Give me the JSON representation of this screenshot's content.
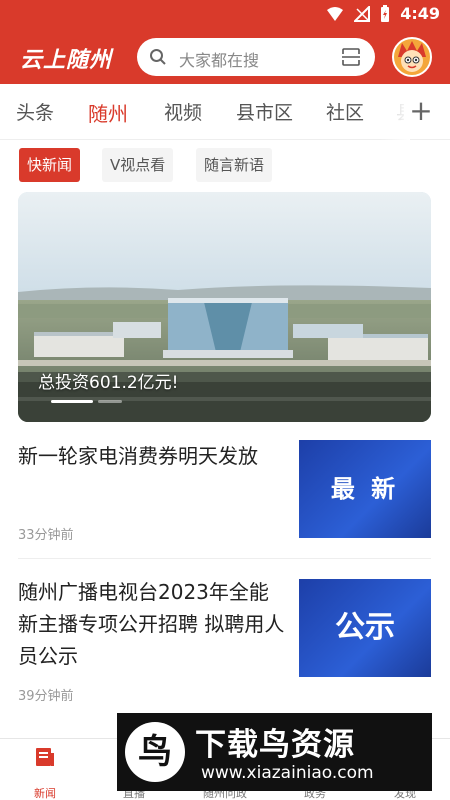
{
  "status_bar": {
    "time": "4:49"
  },
  "header": {
    "logo": "云上随州",
    "search_placeholder": "大家都在搜"
  },
  "channels": {
    "items": [
      {
        "label": "头条"
      },
      {
        "label": "随州"
      },
      {
        "label": "视频"
      },
      {
        "label": "县市区"
      },
      {
        "label": "社区"
      },
      {
        "label": "县"
      }
    ],
    "add_label": "+"
  },
  "sub_tabs": [
    {
      "label": "快新闻"
    },
    {
      "label": "V视点看"
    },
    {
      "label": "随言新语"
    }
  ],
  "banner": {
    "caption": "总投资601.2亿元!"
  },
  "news": [
    {
      "title": "新一轮家电消费券明天发放",
      "time": "33分钟前",
      "thumb_text": "最 新"
    },
    {
      "title": "随州广播电视台2023年全能新主播专项公开招聘 拟聘用人员公示",
      "time": "39分钟前",
      "thumb_text": "公示"
    }
  ],
  "bottom_nav": [
    {
      "label": "新闻"
    },
    {
      "label": "直播"
    },
    {
      "label": "随州问政"
    },
    {
      "label": "政务"
    },
    {
      "label": "发现"
    }
  ],
  "watermark": {
    "badge": "鸟",
    "title": "下载鸟资源",
    "url": "www.xiazainiao.com"
  },
  "colors": {
    "brand_red": "#d93a2b",
    "thumb_blue": "#1d3fa8"
  }
}
